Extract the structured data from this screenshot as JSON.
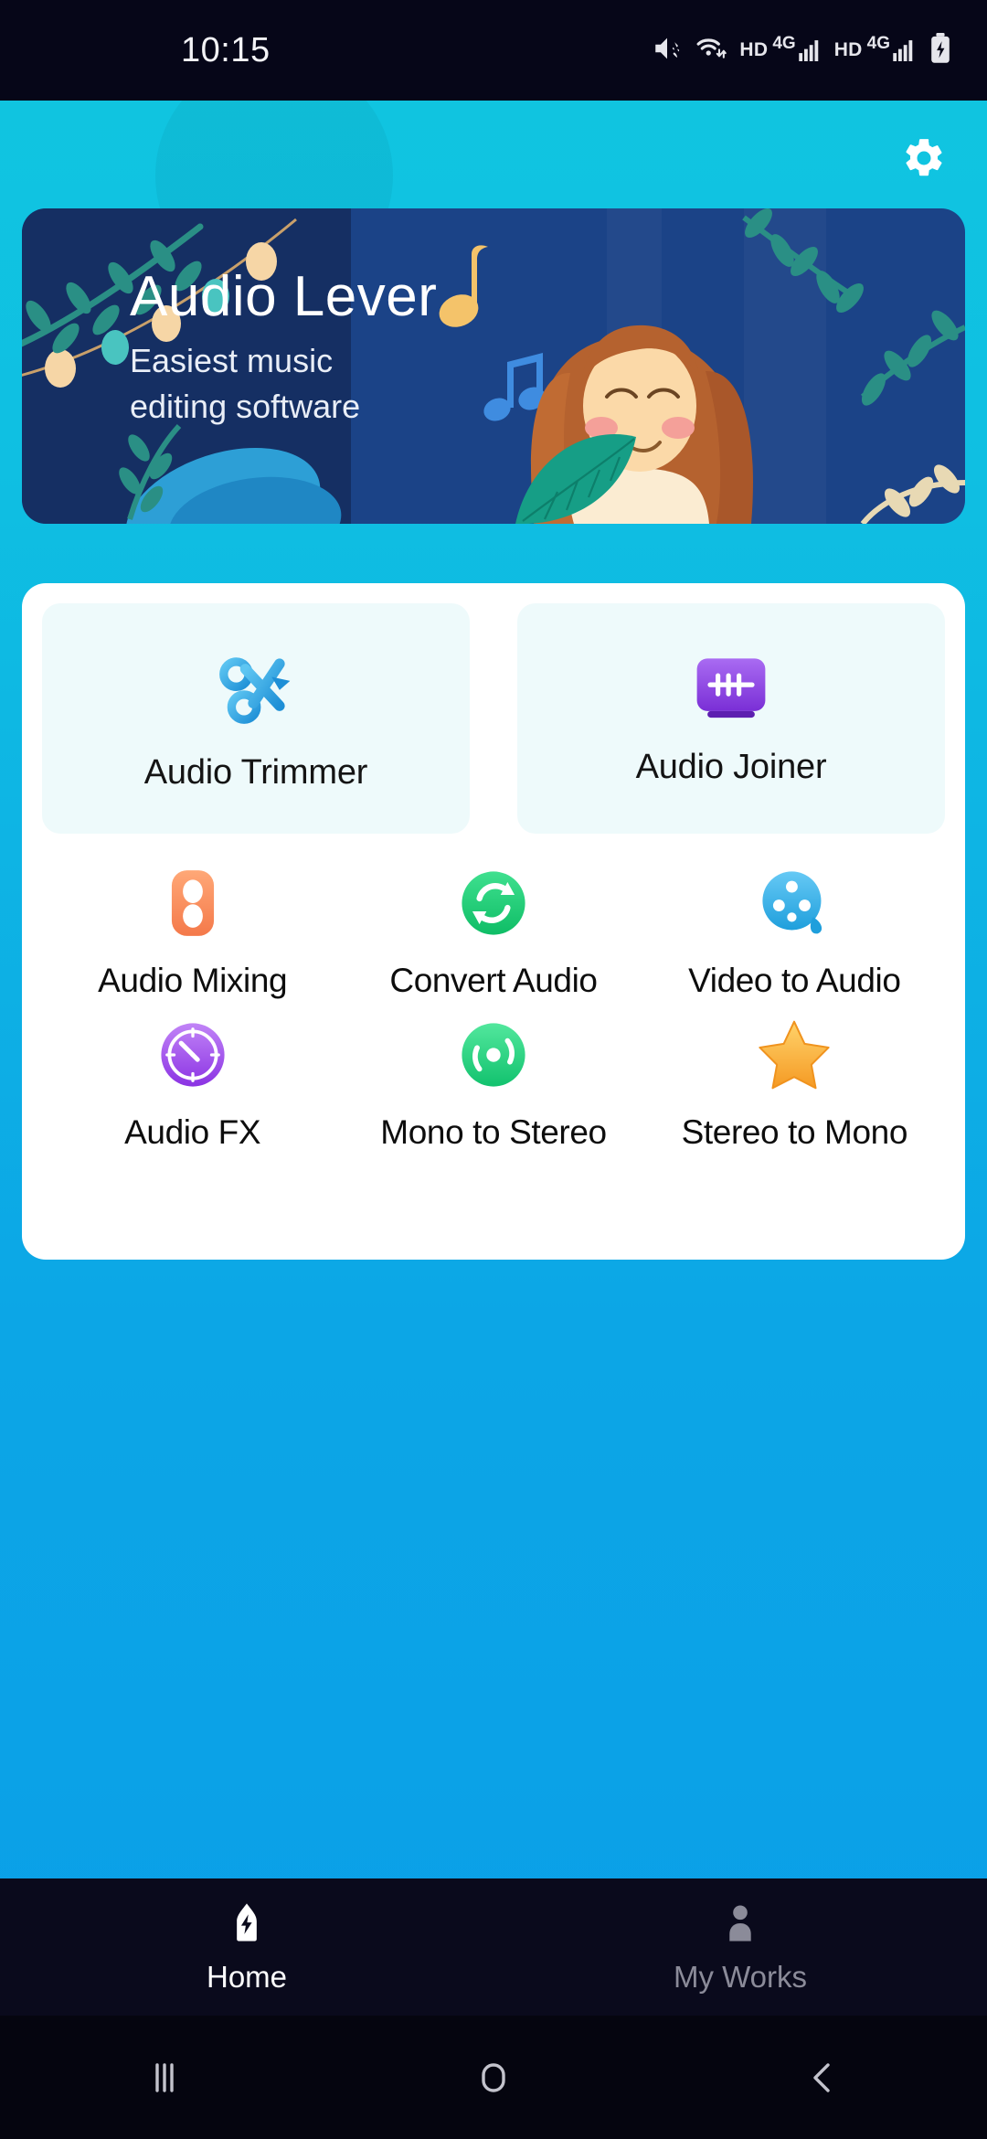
{
  "status_bar": {
    "time": "10:15",
    "icons": [
      {
        "name": "mute-icon"
      },
      {
        "name": "wifi-icon"
      },
      {
        "name": "hd-label-sim1",
        "text": "HD"
      },
      {
        "name": "network-4g-sim1",
        "text": "4G"
      },
      {
        "name": "signal-bars-sim1"
      },
      {
        "name": "hd-label-sim2",
        "text": "HD"
      },
      {
        "name": "network-4g-sim2",
        "text": "4G"
      },
      {
        "name": "signal-bars-sim2"
      },
      {
        "name": "battery-charging-icon"
      }
    ]
  },
  "header": {
    "settings_icon": "gear-icon"
  },
  "banner": {
    "title": "Audio Lever",
    "subtitle_line1": "Easiest music",
    "subtitle_line2": "editing software",
    "bg_color": "#1b4387",
    "bg_dark_color": "#152f63"
  },
  "tools": {
    "featured": [
      {
        "id": "audio-trimmer",
        "label": "Audio Trimmer",
        "icon": "scissors-icon",
        "color": "#3aa6e8",
        "card_bg": "#eefafb"
      },
      {
        "id": "audio-joiner",
        "label": "Audio Joiner",
        "icon": "joiner-icon",
        "color": "#9b52e8",
        "card_bg": "#eefafb"
      }
    ],
    "grid": [
      {
        "id": "audio-mixing",
        "label": "Audio Mixing",
        "icon": "mixer-icon",
        "color": "#f99160"
      },
      {
        "id": "convert-audio",
        "label": "Convert Audio",
        "icon": "sync-arrows-icon",
        "color": "#1fd47a"
      },
      {
        "id": "video-to-audio",
        "label": "Video to Audio",
        "icon": "film-reel-icon",
        "color": "#3fb8ee"
      },
      {
        "id": "audio-fx",
        "label": "Audio FX",
        "icon": "clock-icon",
        "color": "#a458ee"
      },
      {
        "id": "mono-to-stereo",
        "label": "Mono to Stereo",
        "icon": "disc-icon",
        "color": "#22d680"
      },
      {
        "id": "stereo-to-mono",
        "label": "Stereo to Mono",
        "icon": "star-icon",
        "color": "#f7b23d"
      }
    ]
  },
  "bottom_nav": {
    "items": [
      {
        "id": "home",
        "label": "Home",
        "icon": "bolt-shield-icon",
        "active": true
      },
      {
        "id": "my-works",
        "label": "My Works",
        "icon": "person-icon",
        "active": false
      }
    ]
  },
  "android_nav": {
    "recents": "recents-icon",
    "home": "home-circle-icon",
    "back": "back-chevron-icon"
  }
}
